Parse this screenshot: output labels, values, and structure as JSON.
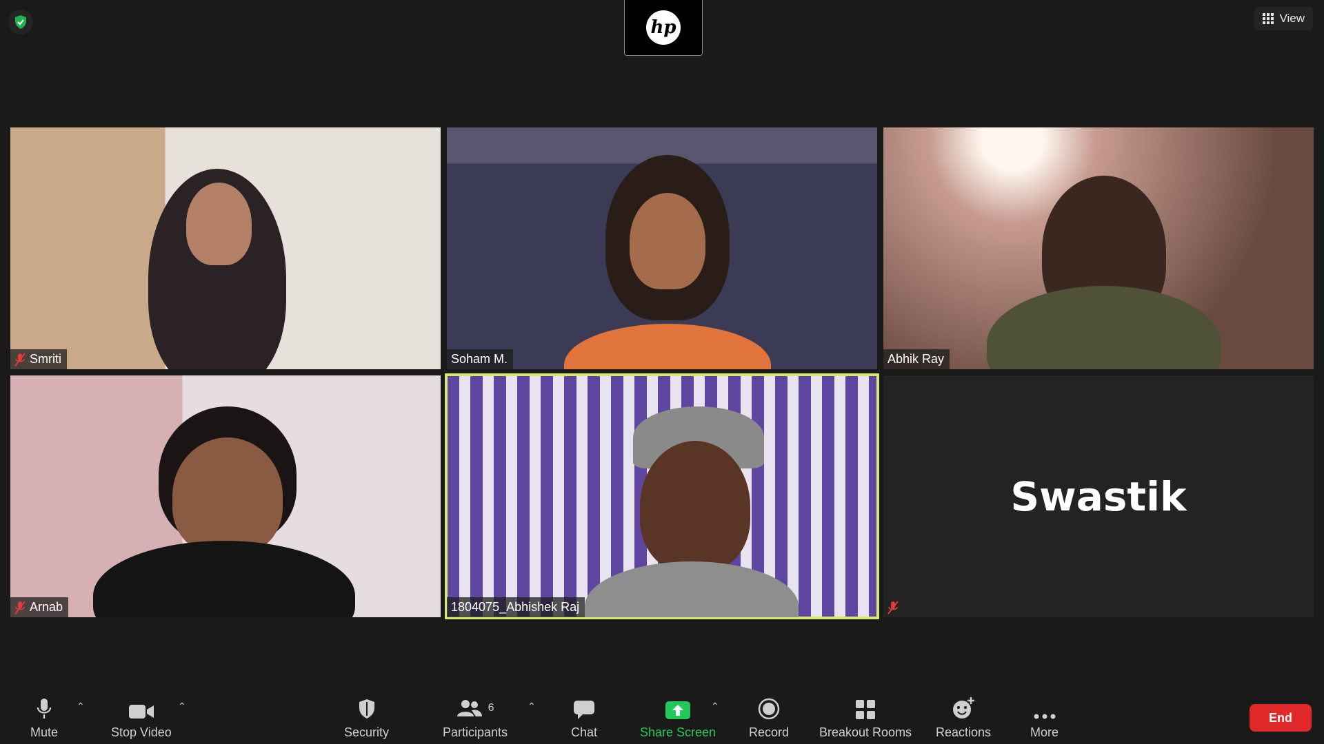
{
  "window": {
    "security_badge": "shield-check-icon",
    "view_label": "View"
  },
  "host": {
    "logo_text": "hp"
  },
  "participants_grid": [
    {
      "name": "Smriti",
      "muted": true
    },
    {
      "name": "Soham M.",
      "muted": false
    },
    {
      "name": "Abhik Ray",
      "muted": false
    },
    {
      "name": "Arnab",
      "muted": true
    },
    {
      "name": "1804075_Abhishek Raj",
      "muted": false,
      "active_speaker": true
    },
    {
      "name": "",
      "display_text": "Swastik",
      "muted": true,
      "video_off": true
    }
  ],
  "toolbar": {
    "mute": "Mute",
    "stop_video": "Stop Video",
    "security": "Security",
    "participants": "Participants",
    "participants_count": "6",
    "chat": "Chat",
    "share_screen": "Share Screen",
    "record": "Record",
    "breakout_rooms": "Breakout Rooms",
    "reactions": "Reactions",
    "more": "More",
    "end": "End"
  },
  "colors": {
    "accent_green": "#22c95a",
    "end_red": "#e02828",
    "active_border": "#d9e86a"
  }
}
